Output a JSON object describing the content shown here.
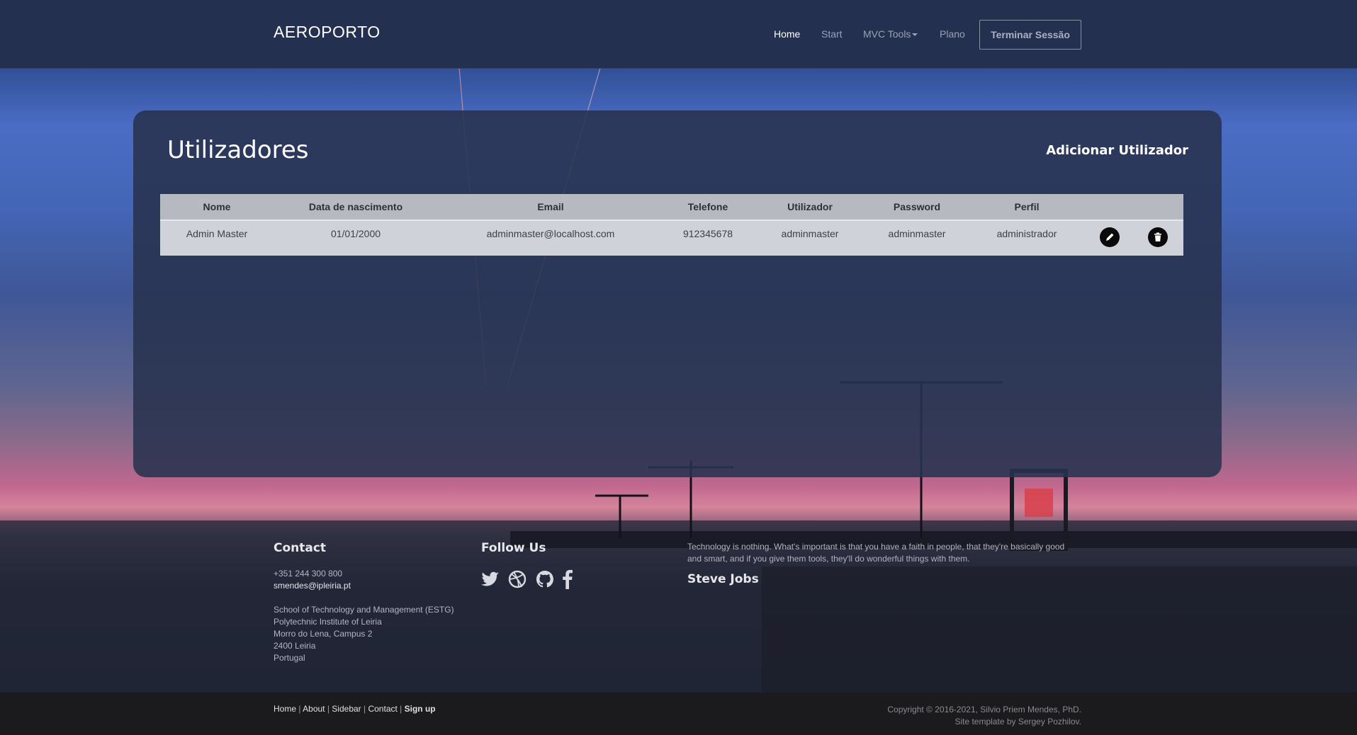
{
  "header": {
    "brand": "AEROPORTO",
    "nav": [
      {
        "label": "Home",
        "active": true
      },
      {
        "label": "Start",
        "active": false
      },
      {
        "label": "MVC Tools",
        "active": false,
        "dropdown": true
      },
      {
        "label": "Plano",
        "active": false
      }
    ],
    "logout_label": "Terminar Sessão"
  },
  "main": {
    "title": "Utilizadores",
    "add_user_label": "Adicionar Utilizador",
    "table": {
      "columns": [
        "Nome",
        "Data de nascimento",
        "Email",
        "Telefone",
        "Utilizador",
        "Password",
        "Perfil"
      ],
      "rows": [
        {
          "nome": "Admin Master",
          "data_nascimento": "01/01/2000",
          "email": "adminmaster@localhost.com",
          "telefone": "912345678",
          "utilizador": "adminmaster",
          "password": "adminmaster",
          "perfil": "administrador"
        }
      ]
    }
  },
  "footer": {
    "contact": {
      "heading": "Contact",
      "phone": "+351 244 300 800",
      "email": "smendes@ipleiria.pt",
      "address": [
        "School of Technology and Management (ESTG)",
        "Polytechnic Institute of Leiria",
        "Morro do Lena, Campus 2",
        "2400 Leiria",
        "Portugal"
      ]
    },
    "follow": {
      "heading": "Follow Us",
      "icons": [
        "twitter-icon",
        "dribbble-icon",
        "github-icon",
        "facebook-icon"
      ]
    },
    "quote": {
      "text": "Technology is nothing. What's important is that you have a faith in people, that they're basically good and smart, and if you give them tools, they'll do wonderful things with them.",
      "author": "Steve Jobs"
    },
    "bottom_links": [
      "Home",
      "About",
      "Sidebar",
      "Contact",
      "Sign up"
    ],
    "copyright": "Copyright © 2016-2021, Silvio Priem Mendes, PhD.",
    "template_credit": "Site template by Sergey Pozhilov."
  }
}
